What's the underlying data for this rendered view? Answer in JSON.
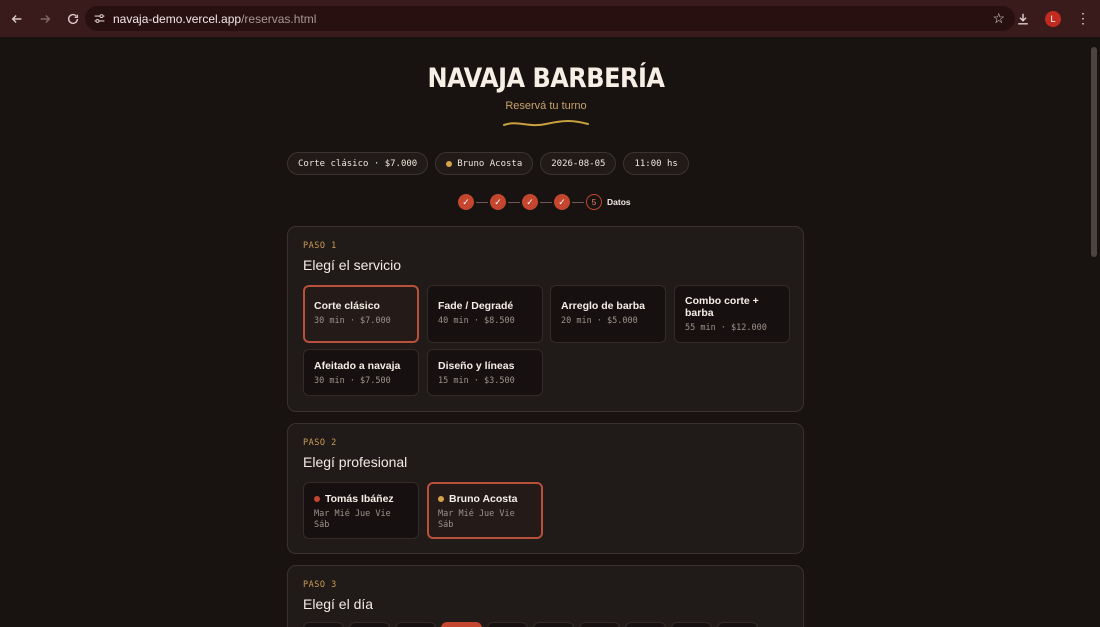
{
  "browser": {
    "url_host": "navaja-demo.vercel.app",
    "url_path": "/reservas.html",
    "profile_initial": "L"
  },
  "header": {
    "brand": "NAVAJA BARBERÍA",
    "tagline": "Reservá tu turno"
  },
  "summary_chips": [
    {
      "label": "Corte clásico · $7.000"
    },
    {
      "label": "Bruno Acosta"
    },
    {
      "label": "2026-08-05"
    },
    {
      "label": "11:00 hs"
    }
  ],
  "stepper": {
    "done_mark": "✓",
    "current_number": "5",
    "current_label": "Datos"
  },
  "step1": {
    "paso": "PASO 1",
    "title": "Elegí el servicio",
    "services": [
      {
        "name": "Corte clásico",
        "meta": "30 min · $7.000",
        "selected": true
      },
      {
        "name": "Fade / Degradé",
        "meta": "40 min · $8.500",
        "selected": false
      },
      {
        "name": "Arreglo de barba",
        "meta": "20 min · $5.000",
        "selected": false
      },
      {
        "name": "Combo corte + barba",
        "meta": "55 min · $12.000",
        "selected": false
      },
      {
        "name": "Afeitado a navaja",
        "meta": "30 min · $7.500",
        "selected": false
      },
      {
        "name": "Diseño y líneas",
        "meta": "15 min · $3.500",
        "selected": false
      }
    ]
  },
  "step2": {
    "paso": "PASO 2",
    "title": "Elegí profesional",
    "barbers": [
      {
        "name": "Tomás Ibáñez",
        "days": "Mar Mié Jue Vie Sáb",
        "dot_color": "#c4462e",
        "selected": false
      },
      {
        "name": "Bruno Acosta",
        "days": "Mar Mié Jue Vie Sáb",
        "dot_color": "#d6a24a",
        "selected": true
      }
    ]
  },
  "step3": {
    "paso": "PASO 3",
    "title": "Elegí el día"
  },
  "colors": {
    "accent": "#c4462e",
    "gold": "#cd9c55",
    "background": "#181311",
    "card": "#201a18"
  }
}
